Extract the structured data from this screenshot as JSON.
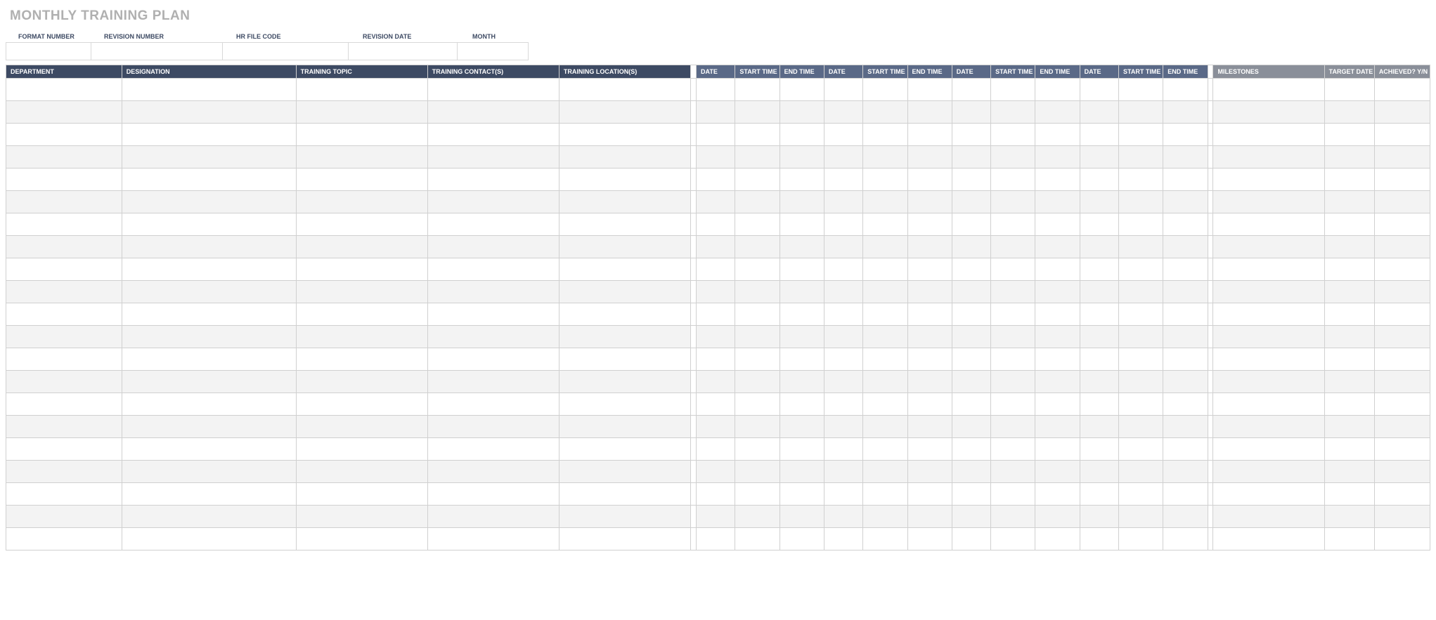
{
  "title": "MONTHLY TRAINING PLAN",
  "meta": {
    "labels": {
      "format_number": "FORMAT NUMBER",
      "revision_number": "REVISION NUMBER",
      "hr_file_code": "HR FILE CODE",
      "revision_date": "REVISION DATE",
      "month": "MONTH"
    },
    "values": {
      "format_number": "",
      "revision_number": "",
      "hr_file_code": "",
      "revision_date": "",
      "month": ""
    }
  },
  "headers": {
    "department": "DEPARTMENT",
    "designation": "DESIGNATION",
    "training_topic": "TRAINING TOPIC",
    "training_contacts": "TRAINING CONTACT(S)",
    "training_locations": "TRAINING LOCATION(S)",
    "date": "DATE",
    "start_time": "START TIME",
    "end_time": "END TIME",
    "milestones": "MILESTONES",
    "target_date": "TARGET DATE",
    "achieved": "ACHIEVED? Y/N"
  },
  "data_rows": 21
}
